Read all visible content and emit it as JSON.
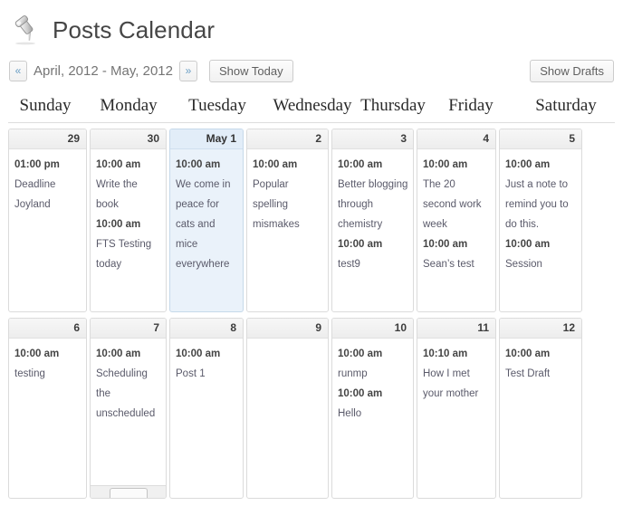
{
  "header": {
    "icon": "pushpin-icon",
    "title": "Posts Calendar"
  },
  "toolbar": {
    "prev_label": "«",
    "next_label": "»",
    "range_label": "April, 2012 - May, 2012",
    "show_today_label": "Show Today",
    "show_drafts_label": "Show Drafts"
  },
  "calendar": {
    "weekdays": [
      "Sunday",
      "Monday",
      "Tuesday",
      "Wednesday",
      "Thursday",
      "Friday",
      "Saturday"
    ],
    "today_highlight_color": "#eaf2fa",
    "weeks": [
      [
        {
          "day": "29",
          "today": false,
          "events": [
            {
              "time": "01:00 pm",
              "title": "Deadline Joyland"
            }
          ]
        },
        {
          "day": "30",
          "today": false,
          "events": [
            {
              "time": "10:00 am",
              "title": "Write the book"
            },
            {
              "time": "10:00 am",
              "title": "FTS Testing today"
            }
          ]
        },
        {
          "day": "May 1",
          "today": true,
          "events": [
            {
              "time": "10:00 am",
              "title": "We come in peace for cats and mice everywhere"
            }
          ]
        },
        {
          "day": "2",
          "today": false,
          "events": [
            {
              "time": "10:00 am",
              "title": "Popular spelling mismakes"
            }
          ]
        },
        {
          "day": "3",
          "today": false,
          "events": [
            {
              "time": "10:00 am",
              "title": "Better blogging through chemistry"
            },
            {
              "time": "10:00 am",
              "title": "test9"
            }
          ]
        },
        {
          "day": "4",
          "today": false,
          "events": [
            {
              "time": "10:00 am",
              "title": "The 20 second work week"
            },
            {
              "time": "10:00 am",
              "title": "Sean’s test"
            }
          ]
        },
        {
          "day": "5",
          "today": false,
          "events": [
            {
              "time": "10:00 am",
              "title": "Just a note to remind you to do this."
            },
            {
              "time": "10:00 am",
              "title": "Session"
            }
          ]
        }
      ],
      [
        {
          "day": "6",
          "today": false,
          "events": [
            {
              "time": "10:00 am",
              "title": "testing"
            }
          ]
        },
        {
          "day": "7",
          "today": false,
          "footer": true,
          "events": [
            {
              "time": "10:00 am",
              "title": "Scheduling the unscheduled"
            }
          ]
        },
        {
          "day": "8",
          "today": false,
          "events": [
            {
              "time": "10:00 am",
              "title": "Post 1"
            }
          ]
        },
        {
          "day": "9",
          "today": false,
          "events": []
        },
        {
          "day": "10",
          "today": false,
          "events": [
            {
              "time": "10:00 am",
              "title": "runmp"
            },
            {
              "time": "10:00 am",
              "title": "Hello"
            }
          ]
        },
        {
          "day": "11",
          "today": false,
          "events": [
            {
              "time": "10:10 am",
              "title": "How I met your mother"
            }
          ]
        },
        {
          "day": "12",
          "today": false,
          "events": [
            {
              "time": "10:00 am",
              "title": "Test Draft"
            }
          ]
        }
      ]
    ]
  }
}
